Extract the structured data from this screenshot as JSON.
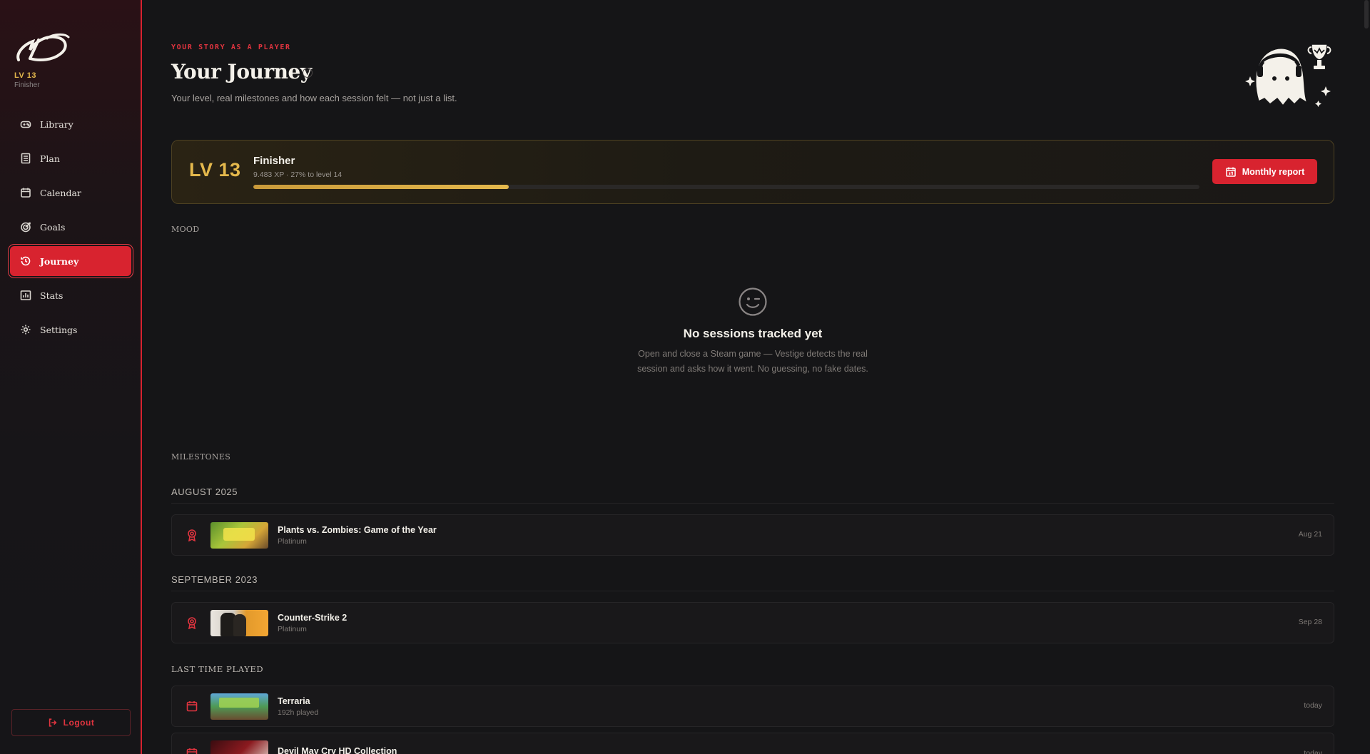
{
  "sidebar": {
    "level": "LV 13",
    "rank": "Finisher",
    "items": [
      {
        "label": "Library",
        "icon": "gamepad-icon"
      },
      {
        "label": "Plan",
        "icon": "list-icon"
      },
      {
        "label": "Calendar",
        "icon": "calendar-icon"
      },
      {
        "label": "Goals",
        "icon": "target-icon"
      },
      {
        "label": "Journey",
        "icon": "history-icon",
        "active": true
      },
      {
        "label": "Stats",
        "icon": "chart-icon"
      },
      {
        "label": "Settings",
        "icon": "gear-icon"
      }
    ],
    "logout_label": "Logout"
  },
  "header": {
    "eyebrow": "YOUR STORY AS A PLAYER",
    "title": "Your Journey",
    "help": "?",
    "subtitle": "Your level, real milestones and how each session felt — not just a list."
  },
  "level_card": {
    "badge": "LV 13",
    "name": "Finisher",
    "xp_text": "9.483 XP · 27% to level 14",
    "progress": 0.27,
    "report_label": "Monthly report"
  },
  "mood": {
    "label": "MOOD",
    "empty_title": "No sessions tracked yet",
    "empty_line1": "Open and close a Steam game — Vestige detects the real",
    "empty_line2": "session and asks how it went. No guessing, no fake dates."
  },
  "milestones": {
    "label": "MILESTONES",
    "groups": [
      {
        "title": "AUGUST 2025",
        "rows": [
          {
            "name": "Plants vs. Zombies: Game of the Year",
            "meta": "Platinum",
            "date": "Aug 21"
          }
        ]
      },
      {
        "title": "SEPTEMBER 2023",
        "rows": [
          {
            "name": "Counter-Strike 2",
            "meta": "Platinum",
            "date": "Sep 28"
          }
        ]
      }
    ]
  },
  "last_played": {
    "label": "LAST TIME PLAYED",
    "rows": [
      {
        "name": "Terraria",
        "meta": "192h played",
        "date": "today"
      },
      {
        "name": "Devil May Cry HD Collection",
        "meta": "",
        "date": "today"
      }
    ]
  },
  "colors": {
    "accent": "#d8232f",
    "gold": "#e4b84c",
    "background": "#151517"
  }
}
